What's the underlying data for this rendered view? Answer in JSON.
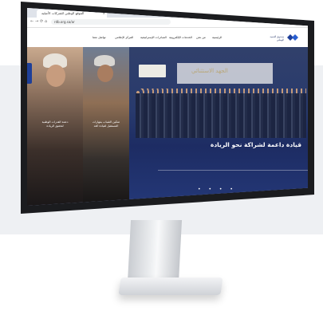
{
  "browser": {
    "tab_title": "الموقع الوطني للشركات الأصلية",
    "tab_close": "×",
    "window_controls": "– □ ×",
    "url": "rdb.org.sa/ar",
    "nav_back": "←",
    "nav_forward": "→",
    "nav_reload": "⟳",
    "nav_home": "⌂"
  },
  "site": {
    "logo_text": [
      "صندوق التنمية",
      "الوطني"
    ],
    "nav": [
      {
        "label": "الرئيسية"
      },
      {
        "label": "من نحن"
      },
      {
        "label": "الخدمات الإلكترونية"
      },
      {
        "label": "المبادرات الإستراتيجية"
      },
      {
        "label": "المركز الإعلامي"
      },
      {
        "label": "تواصل معنا"
      }
    ]
  },
  "hero": {
    "caption": "قيادة داعمة لشراكة نحو الريادة",
    "panel1_text": [
      "دعمة القدرات الوطنية",
      "لتحقيق الريادة"
    ],
    "panel2_text": [
      "تمكين الشباب بمهارات",
      "المستقبل لقيادة الغد"
    ],
    "stage_title": "الجهد الاستثنائي",
    "slider_dots": "• • • •"
  },
  "colors": {
    "hero_blue": "#1f2f6a",
    "bezel": "#1b1c1f",
    "brand_blue": "#1e3f99"
  }
}
